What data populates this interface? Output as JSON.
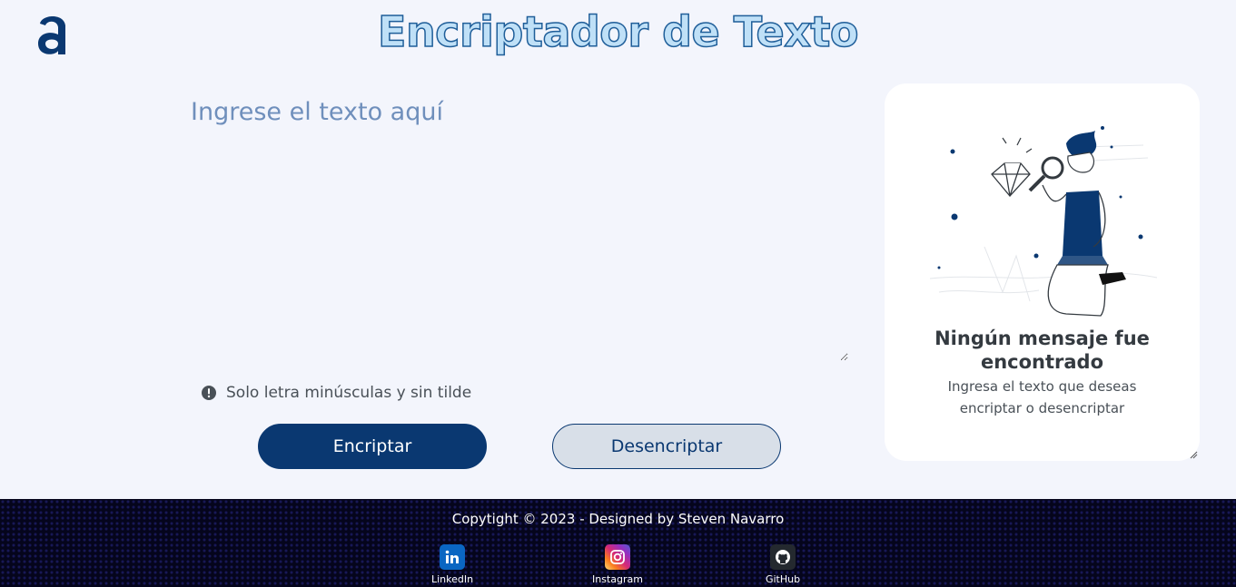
{
  "header": {
    "title": "Encriptador de Texto"
  },
  "editor": {
    "placeholder": "Ingrese el texto aquí"
  },
  "notice": {
    "text": "Solo letra minúsculas y sin tilde"
  },
  "buttons": {
    "encrypt": "Encriptar",
    "decrypt": "Desencriptar"
  },
  "result": {
    "title": "Ningún mensaje fue encontrado",
    "subtitle": "Ingresa el texto que deseas encriptar o desencriptar"
  },
  "footer": {
    "copyright": "Copytight © 2023 - Designed by Steven Navarro",
    "links": [
      {
        "label": "LinkedIn",
        "icon": "linkedin-icon"
      },
      {
        "label": "Instagram",
        "icon": "instagram-icon"
      },
      {
        "label": "GitHub",
        "icon": "github-icon"
      }
    ]
  },
  "colors": {
    "primary": "#0a3871",
    "background": "#f3f5fc",
    "footer": "#05051c"
  }
}
